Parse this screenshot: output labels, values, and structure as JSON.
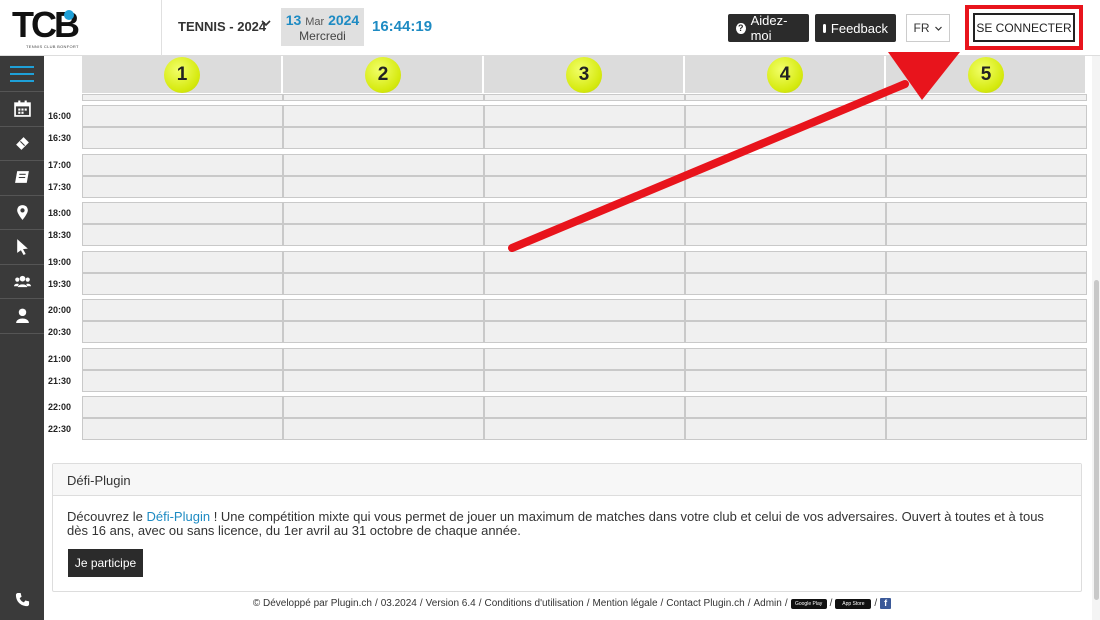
{
  "header": {
    "logo_text": "TCB",
    "logo_subtitle": "TENNIS CLUB BONFORT",
    "sport_selector": "TENNIS - 2024",
    "date": {
      "day": "13",
      "month": "Mar",
      "year": "2024",
      "weekday": "Mercredi"
    },
    "clock": "16:44:19",
    "help_label": "Aidez-moi",
    "feedback_label": "Feedback",
    "language": "FR",
    "connect_label": "SE CONNECTER"
  },
  "sidebar": {
    "icons": [
      "menu-icon",
      "calendar-icon",
      "ticket-icon",
      "book-icon",
      "map-marker-icon",
      "cursor-icon",
      "users-icon",
      "user-icon"
    ],
    "bottom_icon": "phone-icon"
  },
  "courts": [
    "1",
    "2",
    "3",
    "4",
    "5"
  ],
  "time_slots": [
    "16:00",
    "16:30",
    "17:00",
    "17:30",
    "18:00",
    "18:30",
    "19:00",
    "19:30",
    "20:00",
    "20:30",
    "21:00",
    "21:30",
    "22:00",
    "22:30"
  ],
  "card": {
    "title": "Défi-Plugin",
    "text_before_link": "Découvrez le ",
    "link_text": "Défi-Plugin",
    "text_after_link": " ! Une compétition mixte qui vous permet de jouer un maximum de matches dans votre club et celui de vos adversaires. Ouvert à toutes et à tous dès 16 ans, avec ou sans licence, du 1er avril au 31 octobre de chaque année.",
    "button_label": "Je participe"
  },
  "footer": {
    "copyright": "© Développé par Plugin.ch",
    "version_date": "03.2024",
    "version": "Version 6.4",
    "conditions": "Conditions d'utilisation",
    "mention": "Mention légale",
    "contact": "Contact Plugin.ch",
    "admin": "Admin",
    "google_play": "Google Play",
    "app_store": "App Store",
    "facebook": "f"
  },
  "colors": {
    "accent": "#1e8bc3",
    "highlight": "#e8141c",
    "ball": "#d6ea10",
    "sidebar": "#3a3a3a"
  }
}
